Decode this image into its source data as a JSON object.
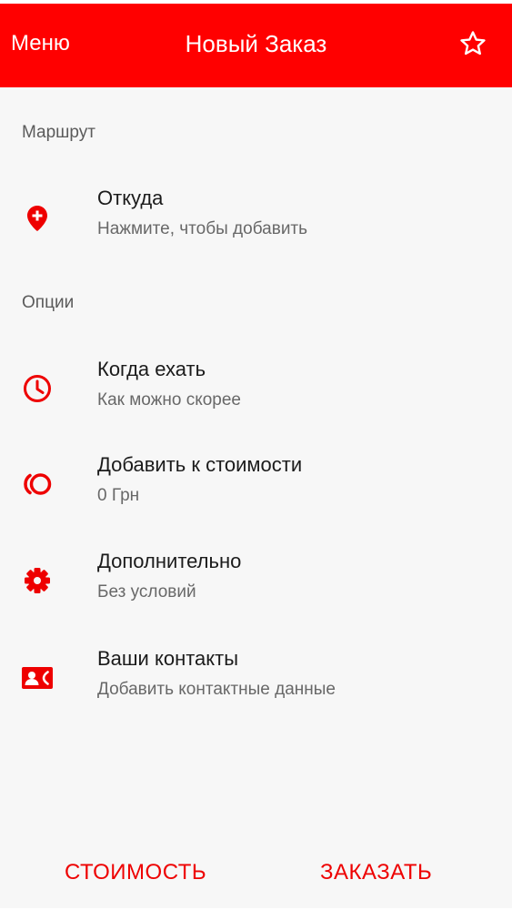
{
  "header": {
    "menu_label": "Меню",
    "title": "Новый Заказ",
    "star_icon": "star-outline-icon"
  },
  "sections": {
    "route_label": "Маршрут",
    "options_label": "Опции"
  },
  "route": {
    "from_title": "Откуда",
    "from_subtitle": "Нажмите, чтобы добавить",
    "from_icon": "map-pin-plus-icon"
  },
  "options": {
    "when": {
      "title": "Когда ехать",
      "subtitle": "Как можно скорее",
      "icon": "clock-icon"
    },
    "add_cost": {
      "title": "Добавить к стоимости",
      "subtitle": "0 Грн",
      "icon": "coin-icon"
    },
    "extra": {
      "title": "Дополнительно",
      "subtitle": "Без условий",
      "icon": "gear-icon"
    },
    "contacts": {
      "title": "Ваши контакты",
      "subtitle": "Добавить контактные данные",
      "icon": "contact-card-icon"
    }
  },
  "footer": {
    "cost_label": "СТОИМОСТЬ",
    "order_label": "ЗАКАЗАТЬ"
  },
  "colors": {
    "accent": "#ff0000",
    "background": "#f7f7f7",
    "text_primary": "#1b1b1b",
    "text_secondary": "#686868"
  }
}
